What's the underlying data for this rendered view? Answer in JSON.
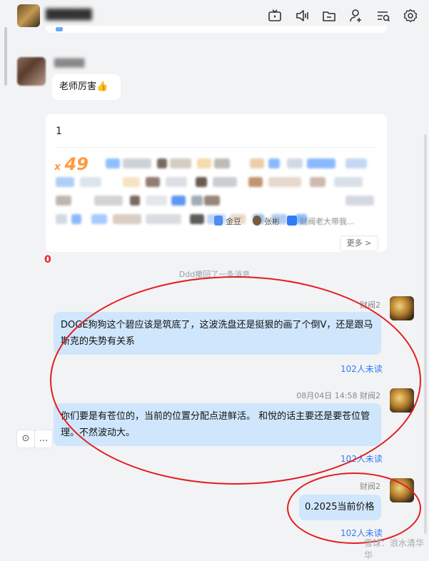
{
  "header": {
    "title": "██████",
    "icons": [
      "tv-icon",
      "volume-icon",
      "folder-icon",
      "add-user-icon",
      "search-list-icon",
      "settings-icon"
    ]
  },
  "messages": {
    "blurred_sender": "█████",
    "praise": "老师厉害👍",
    "card": {
      "title": "1",
      "count_prefix": "x",
      "count": "49",
      "visible_names": [
        "金豆",
        "张彬",
        "财阀老大带我…"
      ],
      "more_label": "更多 >"
    },
    "red_mark": "0",
    "recall_notice": "Ddd撤回了一条消息",
    "m1": {
      "sender": "财阀2",
      "text": "DOGE狗狗这个碧应该是筑底了，这波洗盘还是挺狠的画了个倒V，还是跟马斯克的失势有关系",
      "unread": "102人未读"
    },
    "m2": {
      "time": "08月04日 14:58",
      "sender": "财阀2",
      "text": "你们要是有苍位的，当前的位置分配点进鲜活。 和悅的话主要还是要苍位管理。不然波动大。",
      "unread": "102人未读"
    },
    "m3": {
      "sender": "财阀2",
      "text": "0.2025当前价格",
      "unread": "102人未读"
    },
    "hover_tools": [
      "⊙",
      "…"
    ],
    "watermark": "雪球：浪水清华华"
  },
  "colors": {
    "accent": "#2f7cf6",
    "self_bubble": "#cfe6fd",
    "annotation": "#e41c1c",
    "count": "#ff9a3c"
  }
}
